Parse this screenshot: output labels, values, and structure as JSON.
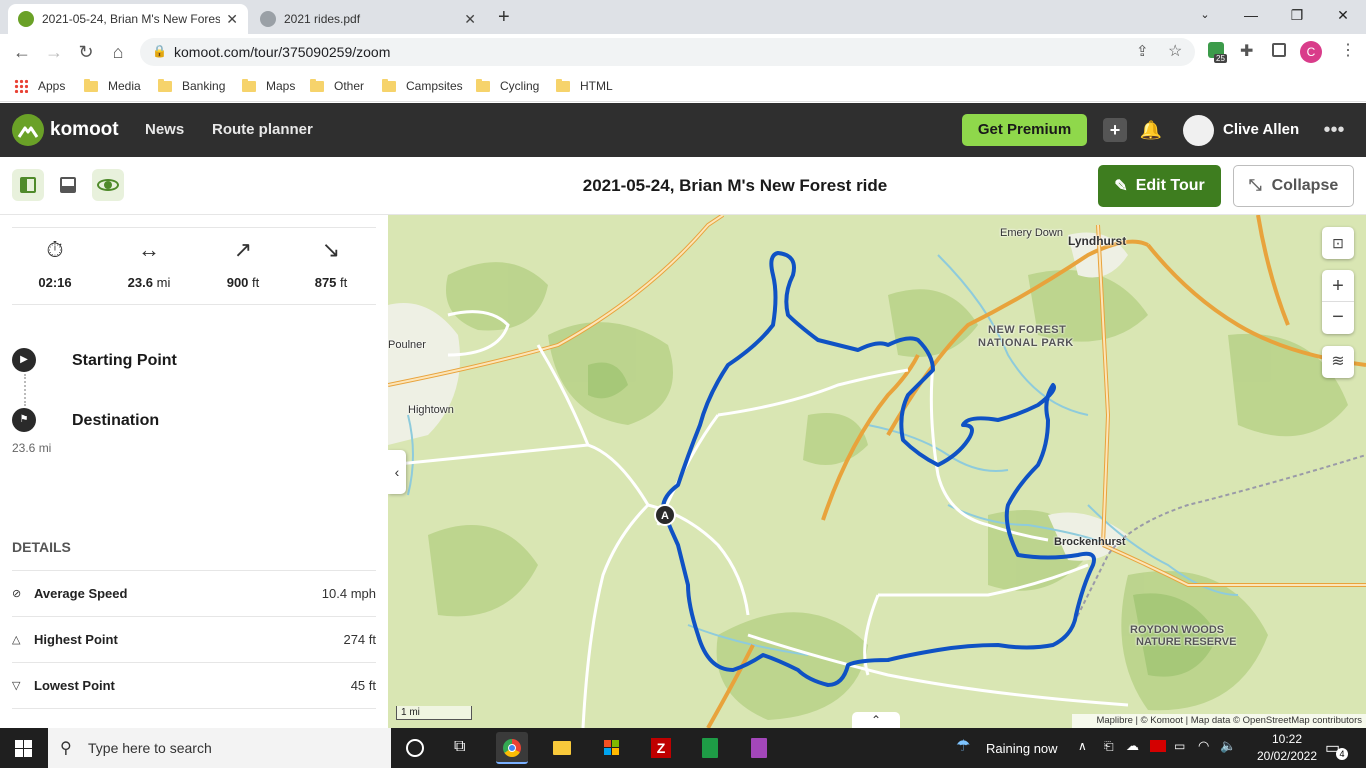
{
  "browser": {
    "tabs": [
      {
        "title": "2021-05-24, Brian M's New Forest ride",
        "active": true
      },
      {
        "title": "2021 rides.pdf",
        "active": false
      }
    ],
    "url": "komoot.com/tour/375090259/zoom",
    "extension_badge": "25",
    "profile_initial": "C",
    "bookmarks": [
      "Apps",
      "Media",
      "Banking",
      "Maps",
      "Other",
      "Campsites",
      "Cycling",
      "HTML"
    ]
  },
  "komoot": {
    "logo_text": "komoot",
    "nav": [
      "News",
      "Route planner"
    ],
    "get_premium": "Get Premium",
    "user_name": "Clive Allen"
  },
  "tour": {
    "title": "2021-05-24, Brian M's New Forest ride",
    "edit_label": "Edit Tour",
    "collapse_label": "Collapse"
  },
  "stats": [
    {
      "icon": "stopwatch-icon",
      "value": "02:16",
      "unit": ""
    },
    {
      "icon": "distance-arrows-icon",
      "value": "23.6",
      "unit": "mi"
    },
    {
      "icon": "uphill-arrow-icon",
      "value": "900",
      "unit": "ft"
    },
    {
      "icon": "downhill-arrow-icon",
      "value": "875",
      "unit": "ft"
    }
  ],
  "waypoints": {
    "start": "Starting Point",
    "destination": "Destination",
    "distance": "23.6 mi"
  },
  "details": {
    "heading": "DETAILS",
    "rows": [
      {
        "label": "Average Speed",
        "value": "10.4 mph"
      },
      {
        "label": "Highest Point",
        "value": "274 ft"
      },
      {
        "label": "Lowest Point",
        "value": "45 ft"
      }
    ]
  },
  "map": {
    "labels": {
      "emery_down": "Emery Down",
      "lyndhurst": "Lyndhurst",
      "poulner": "Poulner",
      "hightown": "Hightown",
      "nfnp_1": "NEW FOREST",
      "nfnp_2": "NATIONAL PARK",
      "brockenhurst": "Brockenhurst",
      "roydon_1": "ROYDON WOODS",
      "roydon_2": "NATURE RESERVE"
    },
    "start_marker": "A",
    "scale": "1 mi",
    "attribution": "Maplibre | © Komoot | Map data © OpenStreetMap contributors"
  },
  "taskbar": {
    "search_placeholder": "Type here to search",
    "weather": "Raining now",
    "time": "10:22",
    "date": "20/02/2022",
    "notification_count": "4"
  }
}
